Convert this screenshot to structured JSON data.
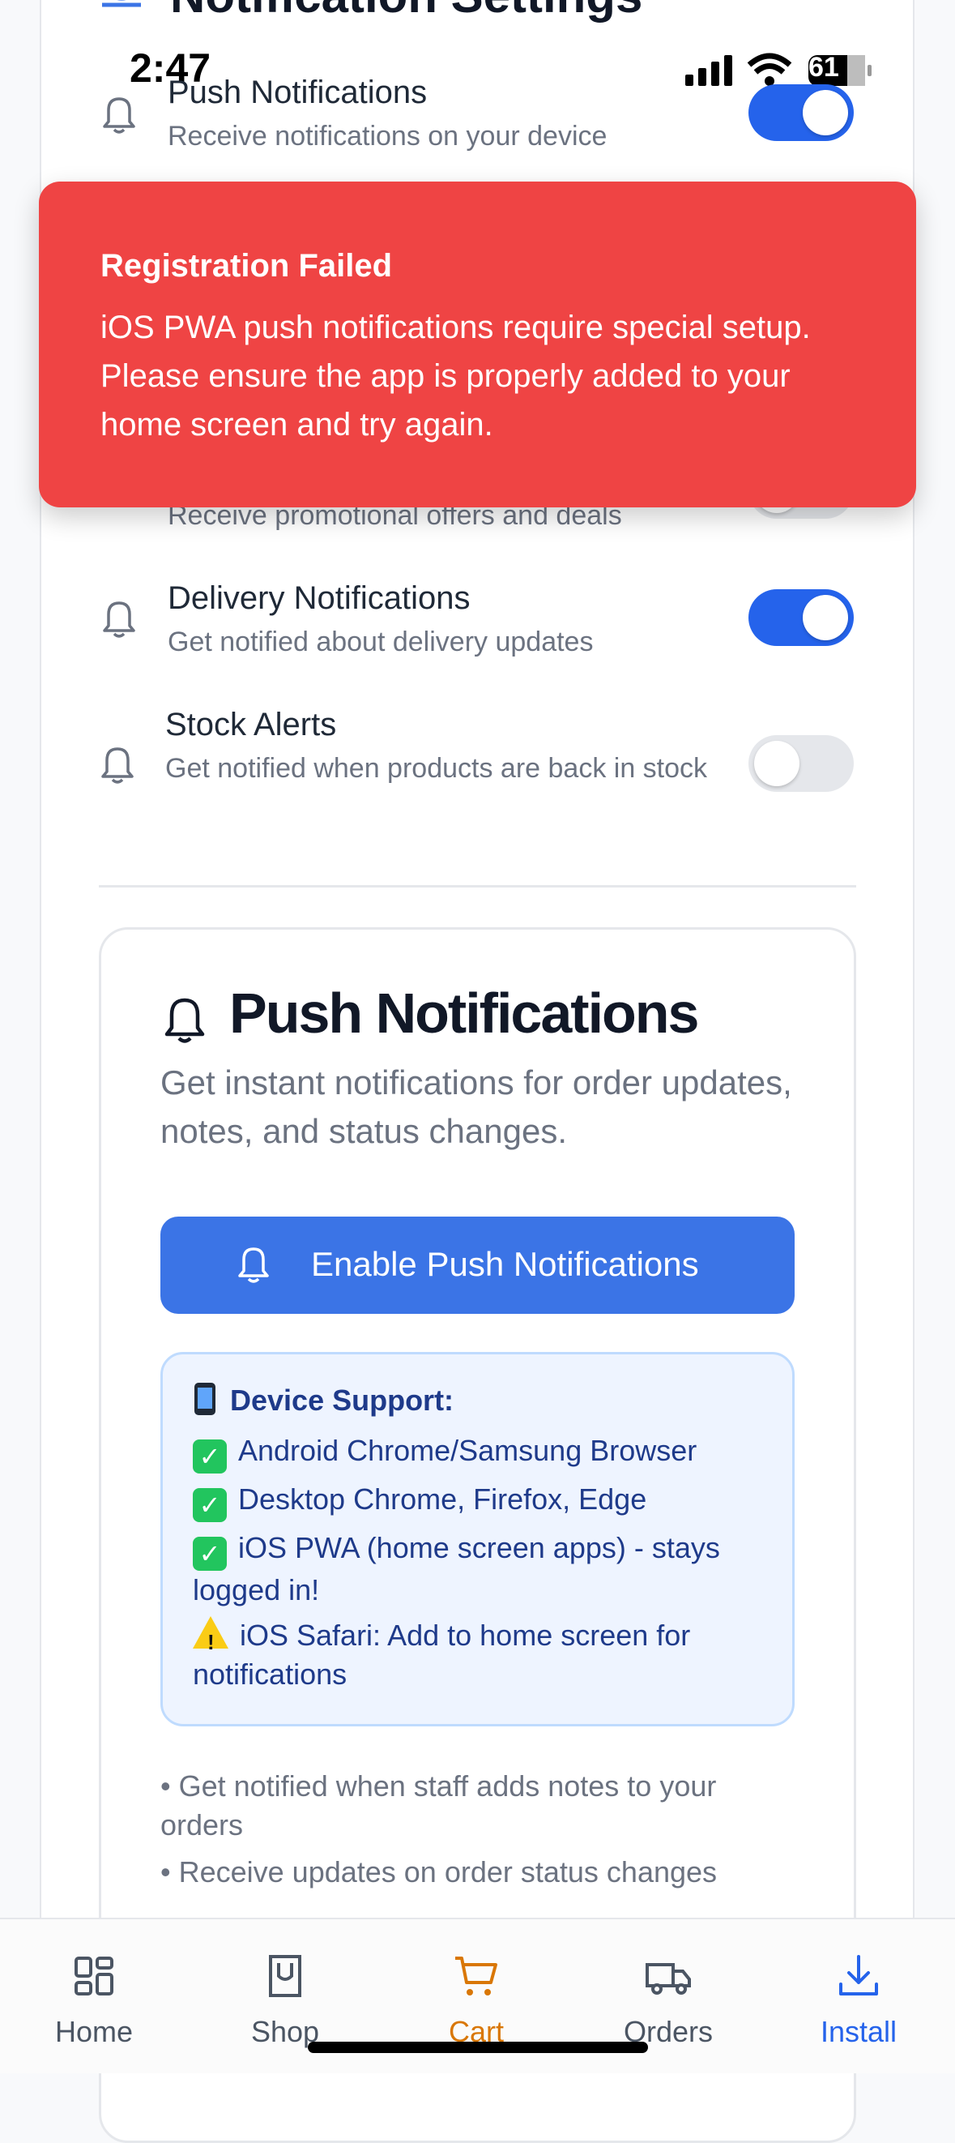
{
  "status_bar": {
    "time": "2:47",
    "battery": "61"
  },
  "header": {
    "title": "Notification Settings"
  },
  "settings": [
    {
      "title": "Push Notifications",
      "description": "Receive notifications on your device",
      "enabled": true
    },
    {
      "title": "",
      "description": "Receive promotional offers and deals",
      "enabled": false
    },
    {
      "title": "Delivery Notifications",
      "description": "Get notified about delivery updates",
      "enabled": true
    },
    {
      "title": "Stock Alerts",
      "description": "Get notified when products are back in stock",
      "enabled": false
    }
  ],
  "toast": {
    "title": "Registration Failed",
    "message": "iOS PWA push notifications require special setup. Please ensure the app is properly added to your home screen and try again.",
    "color": "#ef4444"
  },
  "push_panel": {
    "title": "Push Notifications",
    "description": "Get instant notifications for order updates, notes, and status changes.",
    "button_label": "Enable Push Notifications",
    "support_heading": "Device Support:",
    "support_items": [
      {
        "icon": "check-icon",
        "text": "Android Chrome/Samsung Browser"
      },
      {
        "icon": "check-icon",
        "text": "Desktop Chrome, Firefox, Edge"
      },
      {
        "icon": "check-icon",
        "text": "iOS PWA (home screen apps) - stays logged in!"
      },
      {
        "icon": "warning-icon",
        "text": "iOS Safari: Add to home screen for notifications"
      }
    ],
    "bullets": [
      "Get notified when staff adds notes to your orders",
      "Receive updates on order status changes"
    ]
  },
  "tabbar": {
    "items": [
      {
        "label": "Home",
        "icon": "home-icon",
        "color": "#4b5563"
      },
      {
        "label": "Shop",
        "icon": "shop-icon",
        "color": "#4b5563"
      },
      {
        "label": "Cart",
        "icon": "cart-icon",
        "color": "#d97706"
      },
      {
        "label": "Orders",
        "icon": "truck-icon",
        "color": "#4b5563"
      },
      {
        "label": "Install",
        "icon": "download-icon",
        "color": "#2563eb"
      }
    ]
  },
  "colors": {
    "accent": "#2563eb",
    "button": "#3b74e6",
    "support_bg": "#eef4ff"
  }
}
